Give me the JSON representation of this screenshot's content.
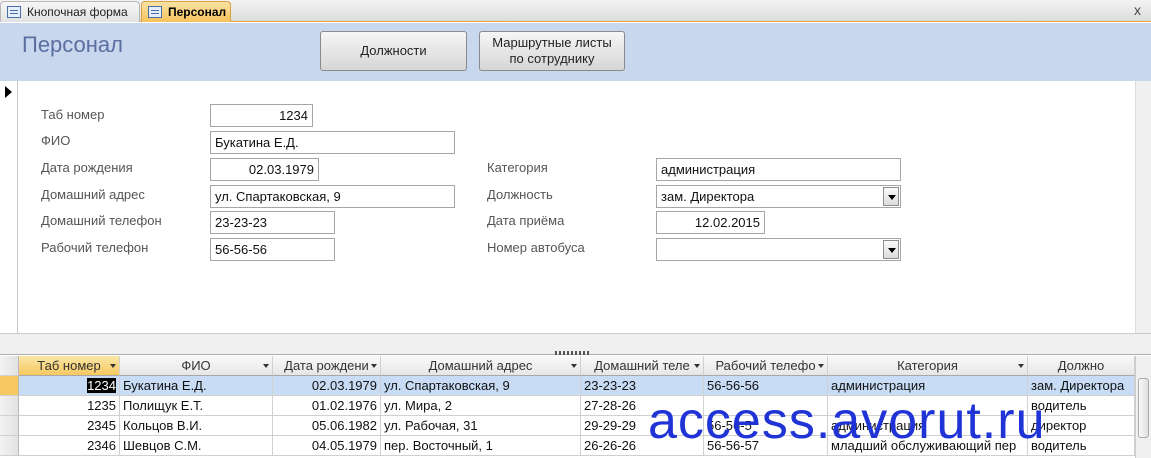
{
  "tabs": [
    {
      "label": "Кнопочная форма",
      "icon": "form-icon"
    },
    {
      "label": "Персонал",
      "icon": "form-icon"
    }
  ],
  "close_label": "x",
  "form": {
    "title": "Персонал",
    "buttons": {
      "positions": "Должности",
      "routes": "Маршрутные листы\nпо сотруднику"
    },
    "labels": {
      "tab": "Таб номер",
      "fio": "ФИО",
      "birth": "Дата рождения",
      "address": "Домашний адрес",
      "home_phone": "Домашний телефон",
      "work_phone": "Рабочий телефон",
      "category": "Категория",
      "position": "Должность",
      "hire_date": "Дата приёма",
      "bus": "Номер автобуса"
    },
    "values": {
      "tab": "1234",
      "fio": "Букатина Е.Д.",
      "birth": "02.03.1979",
      "address": "ул. Спартаковская, 9",
      "home_phone": "23-23-23",
      "work_phone": "56-56-56",
      "category": "администрация",
      "position": "зам. Директора",
      "hire_date": "12.02.2015",
      "bus": ""
    }
  },
  "datasheet": {
    "headers": [
      "Таб номер",
      "ФИО",
      "Дата рождени",
      "Домашний адрес",
      "Домашний теле",
      "Рабочий телефо",
      "Категория",
      "Должно"
    ],
    "rows": [
      [
        "1234",
        "Букатина Е.Д.",
        "02.03.1979",
        "ул. Спартаковская, 9",
        "23-23-23",
        "56-56-56",
        "администрация",
        "зам. Директора"
      ],
      [
        "1235",
        "Полищук Е.Т.",
        "01.02.1976",
        "ул. Мира, 2",
        "27-28-26",
        "",
        "",
        "водитель"
      ],
      [
        "2345",
        "Кольцов В.И.",
        "05.06.1982",
        "ул. Рабочая, 31",
        "29-29-29",
        "56-56-5",
        "администрация",
        "директор"
      ],
      [
        "2346",
        "Шевцов С.М.",
        "04.05.1979",
        "пер. Восточный, 1",
        "26-26-26",
        "56-56-57",
        "младший обслуживающий пер",
        "водитель"
      ]
    ]
  },
  "watermark": "access.avorut.ru",
  "colors": {
    "header_band": "#c9d7ee",
    "active_tab": "#f6c25a",
    "selected_row": "#c8dcf5",
    "watermark": "#1f33d6"
  }
}
